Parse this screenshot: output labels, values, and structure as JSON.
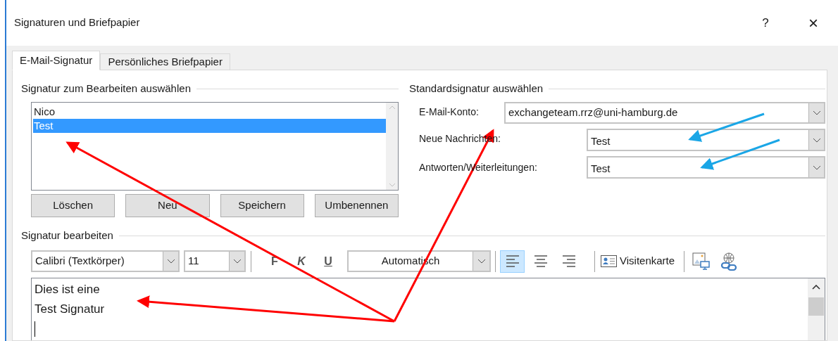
{
  "window": {
    "title": "Signaturen und Briefpapier",
    "help": "?",
    "close": "×"
  },
  "tabs": [
    {
      "label": "E-Mail-Signatur",
      "selected": true
    },
    {
      "label": "Persönliches Briefpapier",
      "selected": false
    }
  ],
  "select_group": {
    "title": "Signatur zum Bearbeiten auswählen",
    "signatures": [
      {
        "label": "Nico",
        "selected": false
      },
      {
        "label": "Test",
        "selected": true
      }
    ],
    "buttons": [
      "Löschen",
      "Neu",
      "Speichern",
      "Umbenennen"
    ]
  },
  "default_group": {
    "title": "Standardsignatur auswählen",
    "fields": [
      {
        "label": "E-Mail-Konto:",
        "value": "exchangeteam.rrz@uni-hamburg.de"
      },
      {
        "label": "Neue Nachrichten:",
        "value": "Test"
      },
      {
        "label": "Antworten/Weiterleitungen:",
        "value": "Test"
      }
    ]
  },
  "edit_group": {
    "title": "Signatur bearbeiten",
    "font": "Calibri (Textkörper)",
    "size": "11",
    "format_buttons": [
      {
        "kind": "bold",
        "label": "F"
      },
      {
        "kind": "italic",
        "label": "K"
      },
      {
        "kind": "underline",
        "label": "U"
      }
    ],
    "font_color": "Automatisch",
    "align_buttons": [
      {
        "kind": "left",
        "selected": true
      },
      {
        "kind": "center",
        "selected": false
      },
      {
        "kind": "right",
        "selected": false
      }
    ],
    "card_button": "Visitenkarte",
    "lines": [
      "Dies ist eine",
      "Test Signatur"
    ]
  }
}
